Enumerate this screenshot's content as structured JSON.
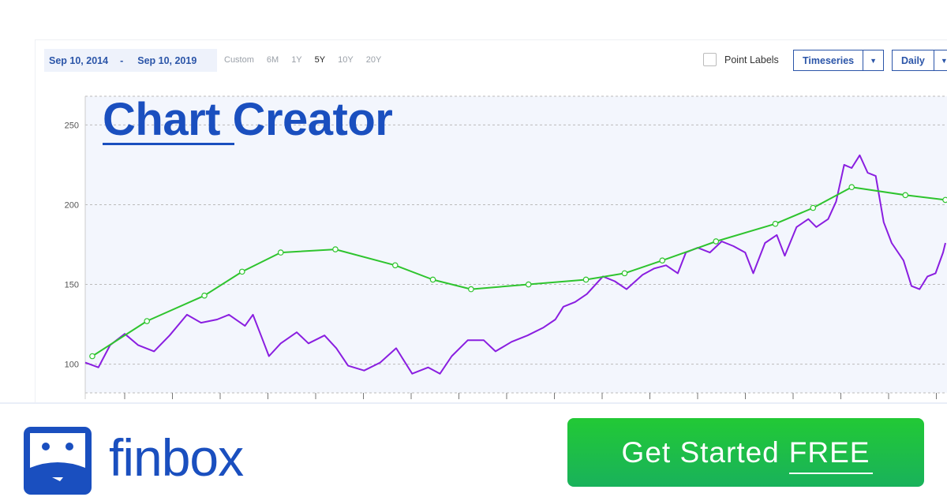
{
  "controls": {
    "start_date": "Sep 10, 2014",
    "separator": "-",
    "end_date": "Sep 10, 2019",
    "presets": [
      "Custom",
      "6M",
      "1Y",
      "5Y",
      "10Y",
      "20Y"
    ],
    "active_preset": "5Y",
    "point_labels": "Point Labels",
    "point_labels_checked": false,
    "chart_type": "Timeseries",
    "frequency": "Daily"
  },
  "title": "Chart Creator",
  "banner": {
    "brand": "finbox",
    "cta_main": "Get Started",
    "cta_emph": "FREE"
  },
  "colors": {
    "brand": "#1a4fbf",
    "price": "#8a1ee0",
    "estimate": "#2ec42e",
    "plot_bg": "#f3f6fd",
    "cta": "#22c935"
  },
  "chart_data": {
    "type": "line",
    "xlim": [
      "2014-09-10",
      "2019-09-10"
    ],
    "ylim": [
      82,
      268
    ],
    "yticks": [
      100,
      150,
      200,
      250
    ],
    "grid": true,
    "series": [
      {
        "color": "#8a1ee0",
        "markers": false,
        "points": [
          [
            "2014-09-10",
            101
          ],
          [
            "2014-10-08",
            98
          ],
          [
            "2014-11-02",
            112
          ],
          [
            "2014-12-03",
            119
          ],
          [
            "2014-12-31",
            112
          ],
          [
            "2015-02-03",
            108
          ],
          [
            "2015-03-08",
            118
          ],
          [
            "2015-04-14",
            131
          ],
          [
            "2015-05-14",
            126
          ],
          [
            "2015-06-17",
            128
          ],
          [
            "2015-07-12",
            131
          ],
          [
            "2015-08-15",
            124
          ],
          [
            "2015-09-01",
            131
          ],
          [
            "2015-09-18",
            118
          ],
          [
            "2015-10-05",
            105
          ],
          [
            "2015-10-30",
            113
          ],
          [
            "2015-12-03",
            120
          ],
          [
            "2015-12-28",
            113
          ],
          [
            "2016-01-31",
            118
          ],
          [
            "2016-02-25",
            110
          ],
          [
            "2016-03-21",
            99
          ],
          [
            "2016-04-24",
            96
          ],
          [
            "2016-05-28",
            101
          ],
          [
            "2016-07-01",
            110
          ],
          [
            "2016-08-04",
            94
          ],
          [
            "2016-09-07",
            98
          ],
          [
            "2016-10-02",
            94
          ],
          [
            "2016-10-27",
            105
          ],
          [
            "2016-11-30",
            115
          ],
          [
            "2017-01-03",
            115
          ],
          [
            "2017-01-28",
            108
          ],
          [
            "2017-03-03",
            114
          ],
          [
            "2017-04-06",
            118
          ],
          [
            "2017-05-10",
            123
          ],
          [
            "2017-06-04",
            128
          ],
          [
            "2017-06-21",
            136
          ],
          [
            "2017-07-16",
            139
          ],
          [
            "2017-08-10",
            144
          ],
          [
            "2017-09-13",
            155
          ],
          [
            "2017-10-08",
            152
          ],
          [
            "2017-11-02",
            147
          ],
          [
            "2017-12-06",
            156
          ],
          [
            "2017-12-31",
            160
          ],
          [
            "2018-01-25",
            162
          ],
          [
            "2018-02-19",
            157
          ],
          [
            "2018-03-08",
            170
          ],
          [
            "2018-04-02",
            173
          ],
          [
            "2018-04-28",
            170
          ],
          [
            "2018-05-23",
            177
          ],
          [
            "2018-06-17",
            174
          ],
          [
            "2018-07-12",
            170
          ],
          [
            "2018-07-29",
            157
          ],
          [
            "2018-08-23",
            176
          ],
          [
            "2018-09-17",
            181
          ],
          [
            "2018-10-04",
            168
          ],
          [
            "2018-10-29",
            186
          ],
          [
            "2018-11-23",
            191
          ],
          [
            "2018-12-10",
            186
          ],
          [
            "2019-01-04",
            191
          ],
          [
            "2019-01-21",
            202
          ],
          [
            "2019-02-07",
            225
          ],
          [
            "2019-02-23",
            223
          ],
          [
            "2019-03-12",
            231
          ],
          [
            "2019-03-29",
            220
          ],
          [
            "2019-04-15",
            218
          ],
          [
            "2019-05-02",
            189
          ],
          [
            "2019-05-19",
            176
          ],
          [
            "2019-06-13",
            165
          ],
          [
            "2019-06-30",
            149
          ],
          [
            "2019-07-17",
            147
          ],
          [
            "2019-08-03",
            155
          ],
          [
            "2019-08-20",
            157
          ],
          [
            "2019-09-05",
            170
          ],
          [
            "2019-09-10",
            176
          ]
        ]
      },
      {
        "color": "#2ec42e",
        "markers": true,
        "points": [
          [
            "2014-09-25",
            105
          ],
          [
            "2015-01-19",
            127
          ],
          [
            "2015-05-21",
            143
          ],
          [
            "2015-08-09",
            158
          ],
          [
            "2015-10-30",
            170
          ],
          [
            "2016-02-23",
            172
          ],
          [
            "2016-06-29",
            162
          ],
          [
            "2016-09-17",
            153
          ],
          [
            "2016-12-07",
            147
          ],
          [
            "2017-04-08",
            150
          ],
          [
            "2017-08-08",
            153
          ],
          [
            "2017-10-29",
            157
          ],
          [
            "2018-01-17",
            165
          ],
          [
            "2018-05-11",
            177
          ],
          [
            "2018-09-14",
            188
          ],
          [
            "2018-12-03",
            198
          ],
          [
            "2019-02-23",
            211
          ],
          [
            "2019-06-17",
            206
          ],
          [
            "2019-09-10",
            203
          ]
        ]
      }
    ]
  }
}
